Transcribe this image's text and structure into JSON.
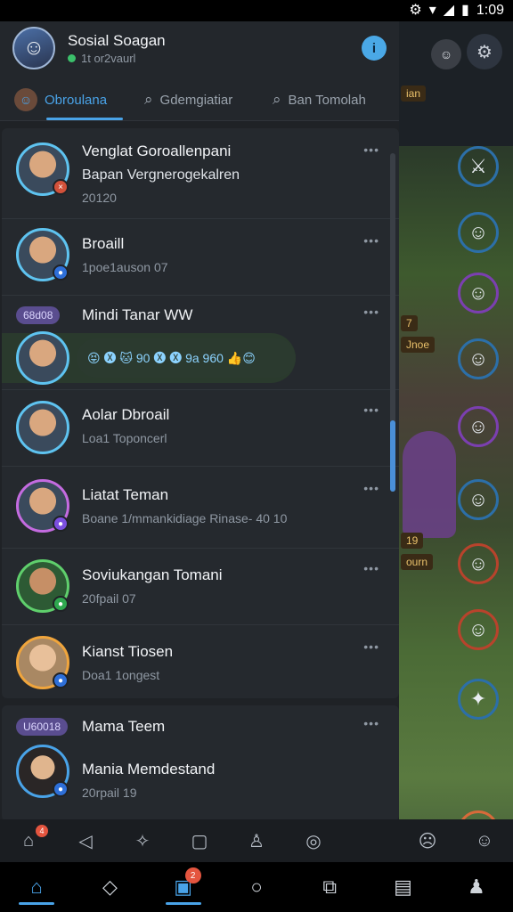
{
  "status_bar": {
    "time": "1:09"
  },
  "header": {
    "title": "Sosial Soagan",
    "subtitle": "1t or2vaurl",
    "info_symbol": "i"
  },
  "tabs": [
    {
      "label": "Obroulana",
      "icon": "avatar-icon",
      "active": true
    },
    {
      "label": "Gdemgiatiar",
      "icon": "search-icon",
      "active": false
    },
    {
      "label": "Ban Tomolah",
      "icon": "search-icon",
      "active": false
    }
  ],
  "list": [
    {
      "name": "Venglat Goroallenpani",
      "line2": "Bapan Vergnerogekalren",
      "line3": "20120"
    },
    {
      "name": "Broaill",
      "line2": "",
      "line3": "1poe1auson 07"
    },
    {
      "pill": "68d08",
      "name": "Mindi Tanar WW",
      "line2": "😝 🅧 🐱 90 🅧 🅧 9a 960 👍😊",
      "line3": ""
    },
    {
      "name": "Aolar Dbroail",
      "line2": "",
      "line3": "Loa1 Toponcerl"
    },
    {
      "name": "Liatat Teman",
      "line2": "",
      "line3": "Boane 1/mmankidiage Rinase- 40 10"
    },
    {
      "name": "Soviukangan Tomani",
      "line2": "",
      "line3": "20fpail 07"
    },
    {
      "name": "Kianst Tiosen",
      "line2": "",
      "line3": "Doa1 1ongest"
    },
    {
      "pill": "U60018",
      "name": "Mama Teem",
      "line2": "",
      "line3": ""
    },
    {
      "name": "Mania Memdestand",
      "line2": "",
      "line3": "20rpail 19"
    }
  ],
  "mini_nav": {
    "badge": "4"
  },
  "bottom_nav": {
    "badge": "2"
  },
  "game": {
    "labels": [
      "7",
      "Jnoe",
      "ian",
      "19",
      "ourn"
    ]
  }
}
